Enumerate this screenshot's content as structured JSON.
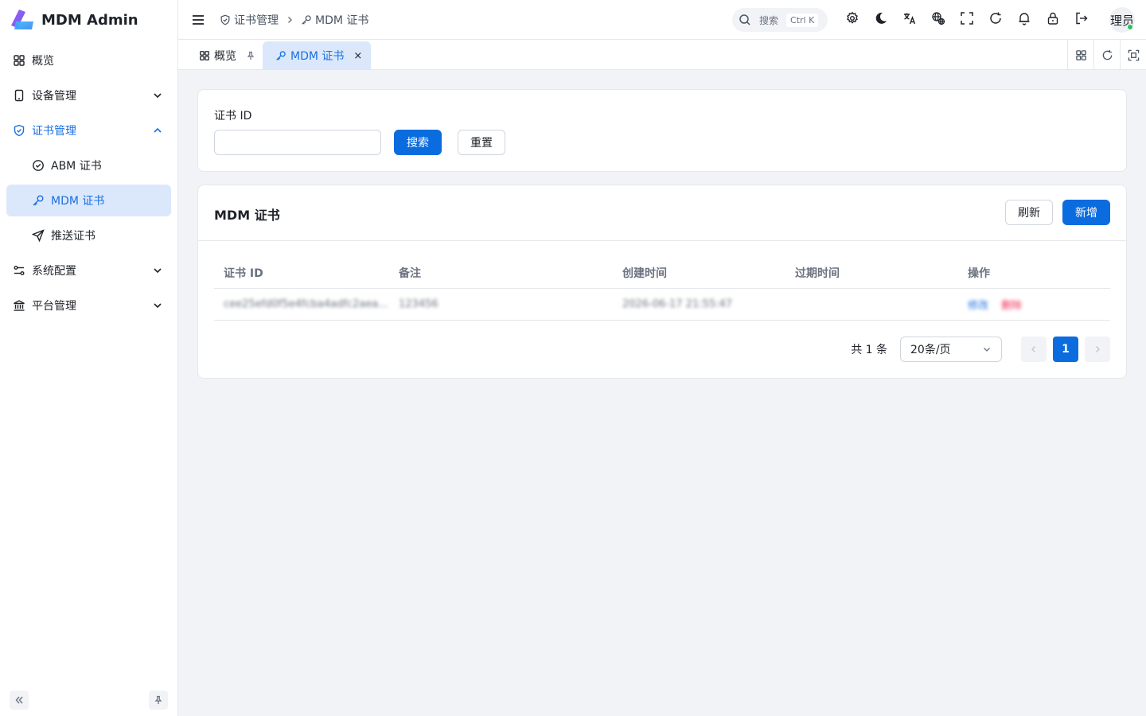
{
  "app": {
    "title": "MDM Admin"
  },
  "sidebar": {
    "items": [
      {
        "label": "概览",
        "icon": "dashboard-icon"
      },
      {
        "label": "设备管理",
        "icon": "device-icon"
      },
      {
        "label": "证书管理",
        "icon": "shield-icon"
      },
      {
        "label": "ABM 证书",
        "icon": "check-circle-icon"
      },
      {
        "label": "MDM 证书",
        "icon": "key-icon"
      },
      {
        "label": "推送证书",
        "icon": "send-icon"
      },
      {
        "label": "系统配置",
        "icon": "settings-sliders-icon"
      },
      {
        "label": "平台管理",
        "icon": "bank-icon"
      }
    ]
  },
  "header": {
    "breadcrumb": [
      "证书管理",
      "MDM 证书"
    ],
    "search_label": "搜索",
    "search_shortcut": "Ctrl K",
    "user_name": "理员"
  },
  "tabs": [
    {
      "label": "概览"
    },
    {
      "label": "MDM 证书",
      "close": "×"
    }
  ],
  "search_form": {
    "field_label": "证书 ID",
    "field_value": "",
    "search_button": "搜索",
    "reset_button": "重置"
  },
  "table": {
    "title": "MDM 证书",
    "refresh_button": "刷新",
    "add_button": "新增",
    "columns": [
      "证书 ID",
      "备注",
      "创建时间",
      "过期时间",
      "操作"
    ],
    "rows": [
      {
        "id": "cee25efd0f5e4fcba4adfc2aea...",
        "note": "123456",
        "created": "2026-06-17 21:55:47",
        "expires": "",
        "edit": "修改",
        "delete": "删除"
      }
    ]
  },
  "pagination": {
    "total": "共 1 条",
    "page_size": "20条/页",
    "current_page": "1"
  },
  "colors": {
    "accent": "#0a6cdf",
    "active_bg": "#dbe8fb",
    "danger": "#ef2b4f",
    "online": "#22c55e"
  }
}
